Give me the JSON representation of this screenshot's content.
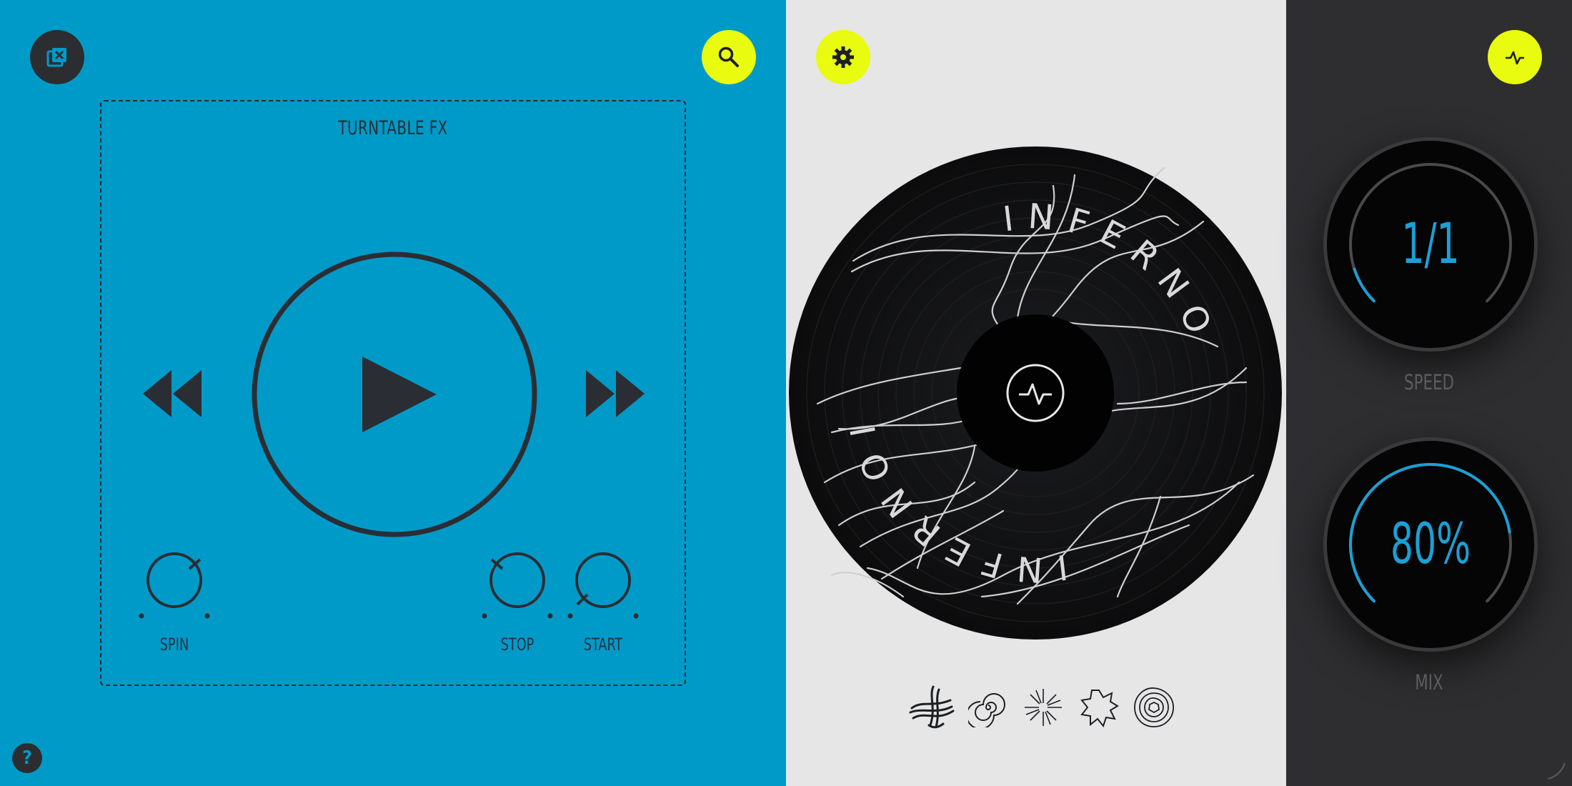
{
  "left_panel": {
    "title": "TURNTABLE FX",
    "knobs": {
      "spin": {
        "label": "SPIN"
      },
      "stop": {
        "label": "STOP"
      },
      "start": {
        "label": "START"
      }
    },
    "help_label": "?"
  },
  "center_panel": {
    "record_label_text": "INFERNO",
    "styles": [
      "wisps-icon",
      "spiral-icon",
      "starburst-icon",
      "splash-icon",
      "rings-icon"
    ],
    "selected_style": "wisps-icon"
  },
  "right_panel": {
    "speed": {
      "value": "1/1",
      "label": "SPEED",
      "level": 0.1
    },
    "mix": {
      "value": "80%",
      "label": "MIX",
      "level": 0.8
    }
  },
  "colors": {
    "left_bg": "#009ac9",
    "center_bg": "#e6e6e6",
    "right_bg": "#2e2e30",
    "accent_lime": "#e9fb0e",
    "accent_blue": "#1aa0d6",
    "dark": "#2b2d31"
  }
}
